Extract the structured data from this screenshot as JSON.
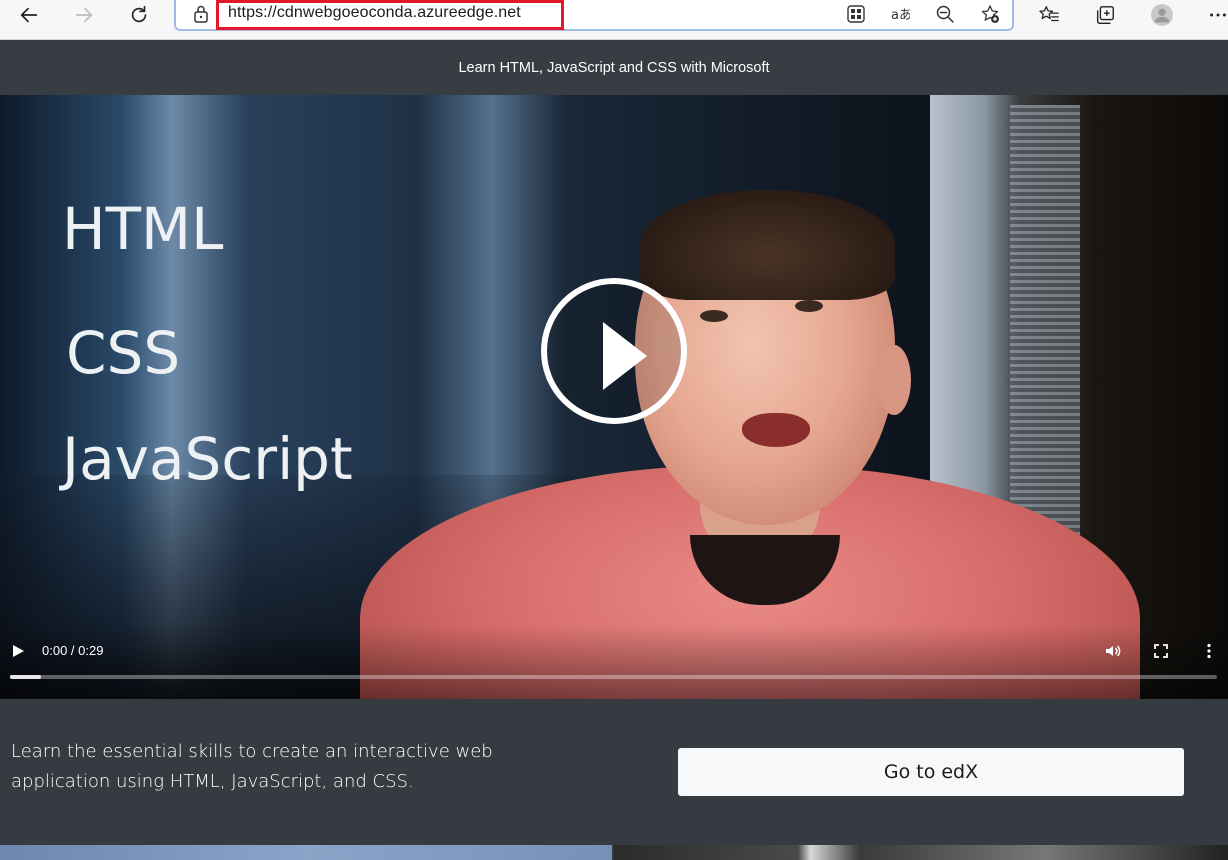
{
  "browser": {
    "url": "https://cdnwebgoeoconda.azureedge.net",
    "icons": [
      "back-icon",
      "forward-icon",
      "refresh-icon",
      "lock-icon",
      "apps-icon",
      "read-aloud-icon",
      "zoom-out-icon",
      "add-favorite-icon",
      "favorites-icon",
      "collections-icon",
      "profile-icon",
      "more-icon"
    ]
  },
  "page": {
    "header_title": "Learn HTML, JavaScript and CSS with Microsoft"
  },
  "video": {
    "overlay_words": [
      "HTML",
      "CSS",
      "JavaScript"
    ],
    "time_display": "0:00 / 0:29",
    "progress_fraction": 0.026
  },
  "description": {
    "text": "Learn the essential skills to create an interactive web application using HTML, JavaScript, and CSS.",
    "button_label": "Go to edX"
  },
  "colors": {
    "background": "#363b42",
    "url_highlight": "#e3162a",
    "button_bg": "#f7f8fa"
  }
}
